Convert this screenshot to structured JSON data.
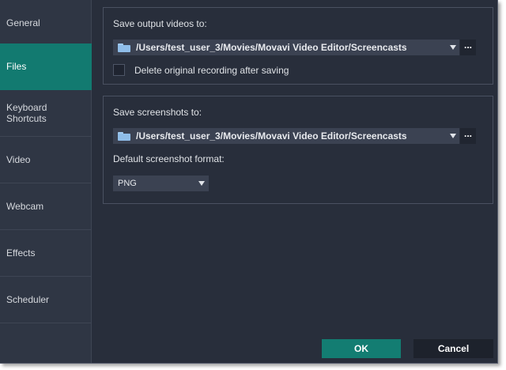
{
  "sidebar": {
    "items": [
      {
        "label": "General"
      },
      {
        "label": "Files"
      },
      {
        "label": "Keyboard\nShortcuts"
      },
      {
        "label": "Video"
      },
      {
        "label": "Webcam"
      },
      {
        "label": "Effects"
      },
      {
        "label": "Scheduler"
      }
    ],
    "active": "Files"
  },
  "videos": {
    "label": "Save output videos to:",
    "path": "/Users/test_user_3/Movies/Movavi Video Editor/Screencasts",
    "browse_label": "...",
    "delete_label": "Delete original recording after saving",
    "delete_checked": false
  },
  "screenshots": {
    "label": "Save screenshots to:",
    "path": "/Users/test_user_3/Movies/Movavi Video Editor/Screencasts",
    "browse_label": "...",
    "format_label": "Default screenshot format:",
    "format_value": "PNG"
  },
  "footer": {
    "ok_label": "OK",
    "cancel_label": "Cancel"
  },
  "colors": {
    "accent": "#127a70",
    "background": "#282e3b",
    "sidebar": "#2f3644"
  }
}
